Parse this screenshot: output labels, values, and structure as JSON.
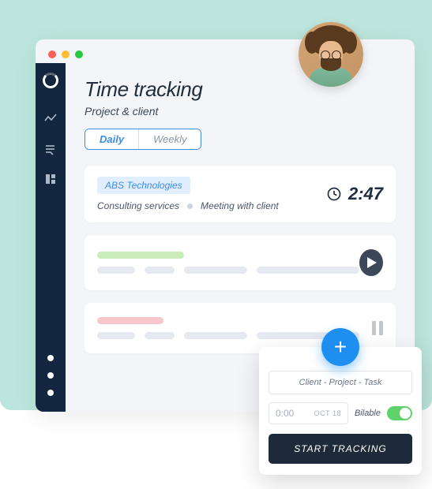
{
  "page": {
    "title": "Time tracking",
    "subtitle": "Project & client"
  },
  "tabs": {
    "daily": "Daily",
    "weekly": "Weekly"
  },
  "entry": {
    "client_tag": "ABS Technologies",
    "project": "Consulting services",
    "task": "Meeting with client",
    "time": "2:47"
  },
  "panel": {
    "placeholder": "Client  -  Project  -  Task",
    "time_value": "0:00",
    "date_label": "OCT 18",
    "billable_label": "Bilable",
    "billable_on": true,
    "start_label": "START TRACKING"
  },
  "colors": {
    "accent": "#1f8ef1",
    "sidebar": "#12263f",
    "mint": "#bce6dd"
  }
}
